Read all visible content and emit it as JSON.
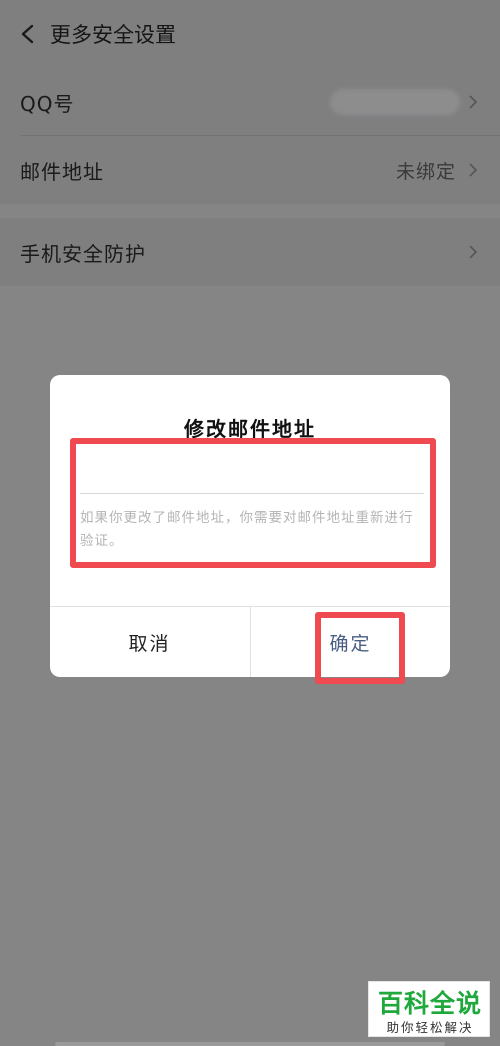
{
  "header": {
    "title": "更多安全设置",
    "back_icon": "chevron-left-icon"
  },
  "settings_group1": [
    {
      "label": "QQ号",
      "value": ""
    },
    {
      "label": "邮件地址",
      "value": "未绑定"
    }
  ],
  "settings_group2": [
    {
      "label": "手机安全防护",
      "value": ""
    }
  ],
  "dialog": {
    "title": "修改邮件地址",
    "email_value": "",
    "hint": "如果你更改了邮件地址，你需要对邮件地址重新进行验证。",
    "cancel_label": "取消",
    "confirm_label": "确定",
    "confirm_color": "#4a5d83"
  },
  "annotation_color": "#ef4a50",
  "watermark": {
    "main": "百科全说",
    "sub": "助你轻松解决",
    "color": "#1fa83b"
  }
}
